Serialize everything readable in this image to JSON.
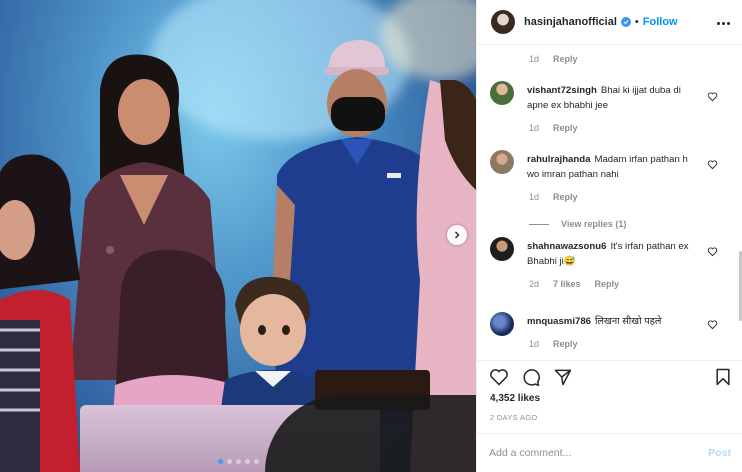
{
  "post": {
    "carousel": {
      "slide_count": 5,
      "active_index": 0
    }
  },
  "header": {
    "username": "hasinjahanofficial",
    "separator": "•",
    "follow_label": "Follow"
  },
  "top_meta": {
    "time": "1d",
    "reply_label": "Reply"
  },
  "comments": [
    {
      "username": "vishant72singh",
      "text": "Bhai ki ijjat duba di apne ex bhabhi jee",
      "time": "1d",
      "likes": "",
      "reply_label": "Reply"
    },
    {
      "username": "rahulrajhanda",
      "text": "Madam irfan pathan h wo imran pathan nahi",
      "time": "1d",
      "likes": "",
      "reply_label": "Reply"
    },
    {
      "username": "shahnawazsonu6",
      "text": "It's irfan pathan ex Bhabhi ji😅",
      "time": "2d",
      "likes": "7 likes",
      "reply_label": "Reply"
    },
    {
      "username": "mnquasmi786",
      "text": "लिखना सीखो पहले",
      "time": "1d",
      "likes": "",
      "reply_label": "Reply"
    }
  ],
  "view_replies_label": "View replies (1)",
  "likes_count": "4,352 likes",
  "timestamp": "2 DAYS AGO",
  "add_comment": {
    "placeholder": "Add a comment...",
    "post_label": "Post"
  },
  "colors": {
    "accent": "#0095f6",
    "verified": "#3897f0",
    "muted": "#8e8e8e",
    "post_disabled": "#b3dbff"
  },
  "icons": [
    "verified-badge-icon",
    "more-options-icon",
    "heart-icon",
    "comment-icon",
    "share-icon",
    "bookmark-icon",
    "chevron-right-icon"
  ]
}
